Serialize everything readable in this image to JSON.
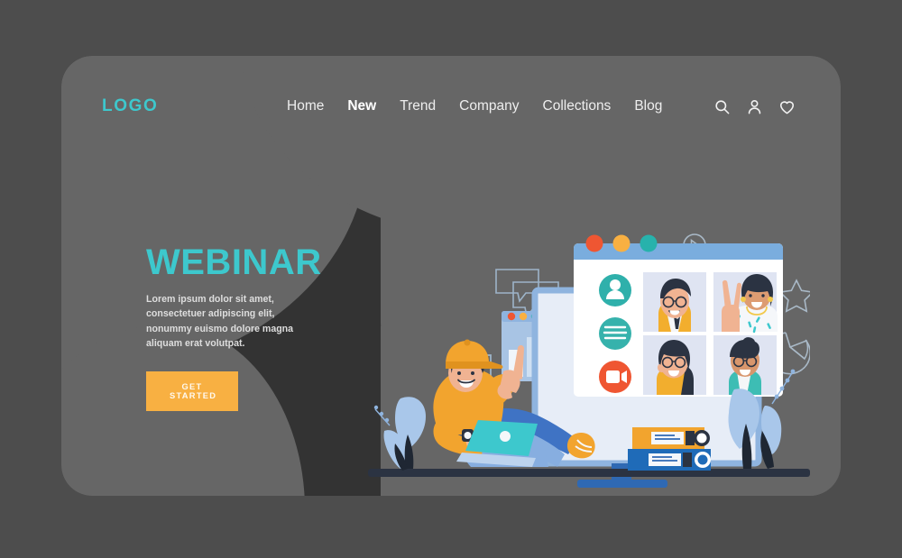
{
  "page": {
    "background_color": "#4d4d4d",
    "card_color": "#333333",
    "card_blob_color": "#666666",
    "accent_teal": "#3dc8cd",
    "accent_orange": "#f8b042"
  },
  "header": {
    "logo": "LOGO",
    "nav": [
      {
        "label": "Home",
        "active": false
      },
      {
        "label": "New",
        "active": true
      },
      {
        "label": "Trend",
        "active": false
      },
      {
        "label": "Company",
        "active": false
      },
      {
        "label": "Collections",
        "active": false
      },
      {
        "label": "Blog",
        "active": false
      }
    ],
    "icons": [
      {
        "name": "search-icon"
      },
      {
        "name": "user-icon"
      },
      {
        "name": "heart-icon"
      }
    ]
  },
  "hero": {
    "title": "WEBINAR",
    "subtitle": "Lorem ipsum dolor sit amet, consectetuer adipiscing elit, nonummy euismo dolore magna aliquam erat volutpat.",
    "cta_label": "GET STARTED"
  },
  "illustration": {
    "scene": "webinar-video-call",
    "video_window": {
      "title_bar_color": "#7aadde",
      "dots": [
        "#ef5632",
        "#f8b042",
        "#27b2ac"
      ],
      "sidebar_icons": [
        {
          "name": "participant-icon",
          "color": "#2fb0ab"
        },
        {
          "name": "menu-list-icon",
          "color": "#2fb0ab"
        },
        {
          "name": "video-camera-icon",
          "color": "#ef5632"
        }
      ],
      "participants": [
        {
          "name": "participant-tile-1",
          "tile_bg": "#dfe4f2"
        },
        {
          "name": "participant-tile-2",
          "tile_bg": "#dfe4f2"
        },
        {
          "name": "participant-tile-3",
          "tile_bg": "#dfe4f2"
        },
        {
          "name": "participant-tile-4",
          "tile_bg": "#dfe4f2"
        }
      ]
    },
    "chart_window": {
      "dots": [
        "#ef5632",
        "#f8b042",
        "#27b2ac"
      ],
      "bars": 3
    },
    "decorations": [
      {
        "name": "chat-bubbles-outline"
      },
      {
        "name": "checkbox-checked-outline"
      },
      {
        "name": "play-button-outline"
      },
      {
        "name": "star-outline"
      },
      {
        "name": "pie-chart-outline"
      },
      {
        "name": "plant-leaves"
      },
      {
        "name": "binder-stack"
      }
    ],
    "person": {
      "name": "seated-person-with-laptop",
      "shirt_color": "#f5a623",
      "cap_color": "#f5a623",
      "jeans_color": "#3f73c4",
      "laptop_color": "#3dc8cd",
      "shoe_color": "#f5a623"
    }
  }
}
